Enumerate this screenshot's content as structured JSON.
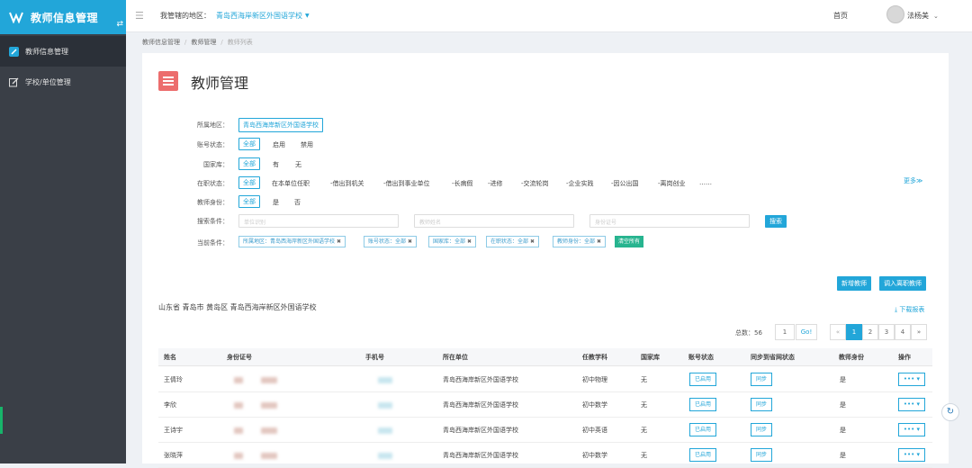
{
  "sidebar": {
    "title": "教师信息管理",
    "items": [
      {
        "label": "教师信息管理",
        "icon": "edit-icon"
      },
      {
        "label": "学校/单位管理",
        "icon": "pencil-icon"
      }
    ]
  },
  "topbar": {
    "region_label": "我管辖的地区：",
    "region_value": "青岛西海岸新区外国语学校",
    "home": "首页",
    "user": "法杨美"
  },
  "breadcrumb": [
    "教师信息管理",
    "教师管理",
    "教师列表"
  ],
  "page": {
    "title": "教师管理"
  },
  "filters": {
    "region_label": "所属地区：",
    "region_value": "青岛西海岸新区外国语学校",
    "account_label": "账号状态：",
    "account_all": "全部",
    "account_opts": [
      "启用",
      "禁用"
    ],
    "talent_label": "国家库：",
    "talent_all": "全部",
    "talent_opts": [
      "有",
      "无"
    ],
    "work_label": "在职状态：",
    "work_all": "全部",
    "work_opts": [
      "在本单位任职",
      "-借出到机关",
      "-借出到事业单位",
      "-长病假",
      "-进修",
      "-交流轮岗",
      "-企业实践",
      "-因公出国",
      "-离岗创业",
      "……"
    ],
    "more": "更多≫",
    "identity_label": "教师身份：",
    "identity_all": "全部",
    "identity_opts": [
      "是",
      "否"
    ],
    "search_label": "搜索条件：",
    "search_placeholders": [
      "单位识别",
      "教师姓名",
      "身份证号"
    ],
    "search_button": "搜索",
    "current_label": "当前条件：",
    "chips": [
      "所属地区：青岛西海岸新区外国语学校",
      "账号状态：全部",
      "国家库：全部",
      "在职状态：全部",
      "教师身份：全部"
    ],
    "clear": "清空所有"
  },
  "actions": {
    "add": "新增教师",
    "import": "调入离职教师"
  },
  "location": "山东省 青岛市 黄岛区 青岛西海岸新区外国语学校",
  "download": "下载报表",
  "pager": {
    "total": "总数：56",
    "page_input": "1",
    "go": "Go!",
    "prev": "«",
    "pages": [
      "1",
      "2",
      "3",
      "4"
    ],
    "next": "»"
  },
  "table": {
    "headers": [
      "姓名",
      "身份证号",
      "手机号",
      "所在单位",
      "任教学科",
      "国家库",
      "账号状态",
      "同步到省网状态",
      "教师身份",
      "操作"
    ],
    "rows": [
      {
        "name": "王倩玲",
        "unit": "青岛西海岸新区外国语学校",
        "subject": "初中物理",
        "talent": "无",
        "status": "已启用",
        "sync": "同步",
        "identity": "是",
        "op": "••• ▾"
      },
      {
        "name": "李欣",
        "unit": "青岛西海岸新区外国语学校",
        "subject": "初中数学",
        "talent": "无",
        "status": "已启用",
        "sync": "同步",
        "identity": "是",
        "op": "••• ▾"
      },
      {
        "name": "王诗宇",
        "unit": "青岛西海岸新区外国语学校",
        "subject": "初中英语",
        "talent": "无",
        "status": "已启用",
        "sync": "同步",
        "identity": "是",
        "op": "••• ▾"
      },
      {
        "name": "张晓萍",
        "unit": "青岛西海岸新区外国语学校",
        "subject": "初中数学",
        "talent": "无",
        "status": "已启用",
        "sync": "同步",
        "identity": "是",
        "op": "••• ▾"
      }
    ]
  },
  "colors": {
    "accent": "#22a6d9",
    "sidebar": "#3a3f47",
    "page_icon": "#ec6d6d",
    "clear": "#27b48f"
  }
}
